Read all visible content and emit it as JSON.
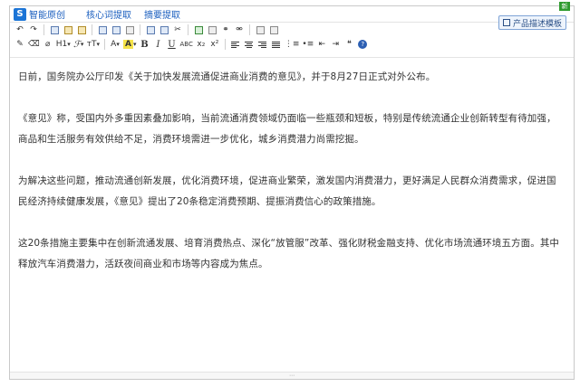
{
  "topbar": {
    "brand": "智能原创",
    "links": [
      "核心词提取",
      "摘要提取"
    ],
    "new_badge": "新",
    "template_button": "产品描述模板"
  },
  "toolbar": {
    "heading": "H1",
    "font": "ℱ",
    "font_size": "тT",
    "font_color": "A",
    "highlight": "A",
    "bold": "B",
    "italic": "I",
    "underline": "U",
    "strike": "ABC",
    "subscript": "x₂",
    "superscript": "x²"
  },
  "content": {
    "paragraphs": [
      "日前，国务院办公厅印发《关于加快发展流通促进商业消费的意见》，并于8月27日正式对外公布。",
      "《意见》称，受国内外多重因素叠加影响，当前流通消费领域仍面临一些瓶颈和短板，特别是传统流通企业创新转型有待加强，商品和生活服务有效供给不足，消费环境需进一步优化，城乡消费潜力尚需挖掘。",
      "为解决这些问题，推动流通创新发展，优化消费环境，促进商业繁荣，激发国内消费潜力，更好满足人民群众消费需求，促进国民经济持续健康发展，《意见》提出了20条稳定消费预期、提振消费信心的政策措施。",
      "这20条措施主要集中在创新流通发展、培育消费热点、深化“放管服”改革、强化财税金融支持、优化市场流通环境五方面。其中释放汽车消费潜力，活跃夜间商业和市场等内容成为焦点。"
    ]
  },
  "resize_handle": "⋯"
}
